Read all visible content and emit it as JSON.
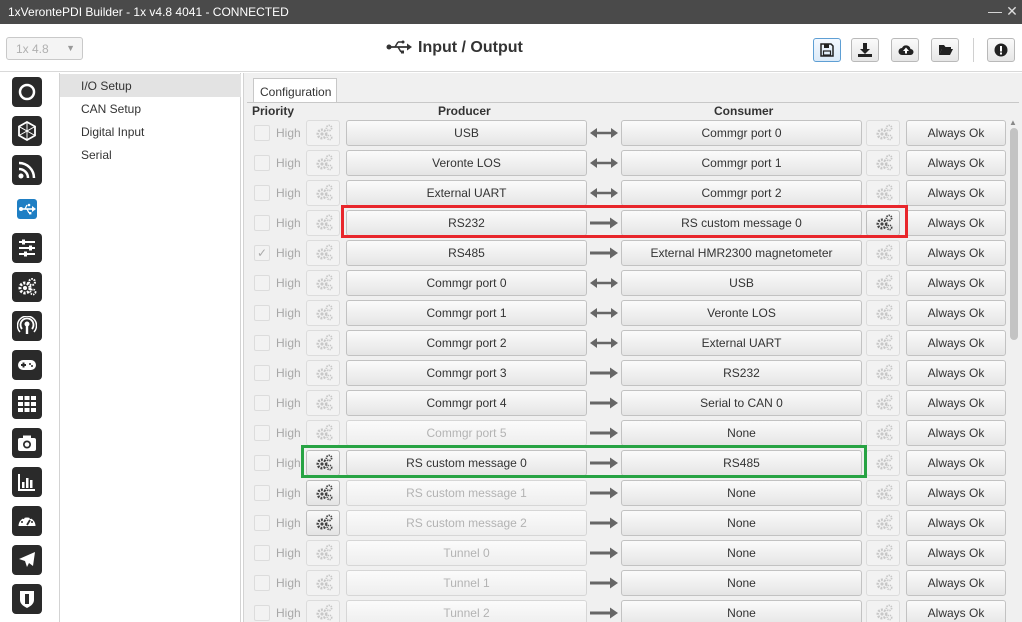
{
  "window": {
    "title": "1xVerontePDI Builder - 1x v4.8 4041 - CONNECTED"
  },
  "header": {
    "version_label": "1x 4.8",
    "page_title": "Input / Output"
  },
  "toolbar": [
    {
      "name": "save",
      "icon": "save-icon",
      "active": true
    },
    {
      "name": "download",
      "icon": "download-icon",
      "active": false
    },
    {
      "name": "upload-cloud",
      "icon": "cloud-upload-icon",
      "active": false
    },
    {
      "name": "open-folder",
      "icon": "folder-open-icon",
      "active": false
    },
    {
      "name": "alert",
      "icon": "exclamation-icon",
      "active": false
    }
  ],
  "rail": [
    {
      "icon": "power-icon",
      "active": false
    },
    {
      "icon": "hexagon-icon",
      "active": false
    },
    {
      "icon": "rss-icon",
      "active": false
    },
    {
      "icon": "usb-icon",
      "active": true
    },
    {
      "icon": "sliders-icon",
      "active": false
    },
    {
      "icon": "gears-icon",
      "active": false
    },
    {
      "icon": "podcast-icon",
      "active": false
    },
    {
      "icon": "gamepad-icon",
      "active": false
    },
    {
      "icon": "grid-icon",
      "active": false
    },
    {
      "icon": "camera-icon",
      "active": false
    },
    {
      "icon": "bar-chart-icon",
      "active": false
    },
    {
      "icon": "gauge-icon",
      "active": false
    },
    {
      "icon": "plane-icon",
      "active": false
    },
    {
      "icon": "shield-icon",
      "active": false
    }
  ],
  "menu": [
    {
      "label": "I/O Setup",
      "active": true
    },
    {
      "label": "CAN Setup",
      "active": false
    },
    {
      "label": "Digital Input",
      "active": false
    },
    {
      "label": "Serial",
      "active": false
    }
  ],
  "tab": {
    "label": "Configuration"
  },
  "columns": {
    "priority": "Priority",
    "producer": "Producer",
    "consumer": "Consumer"
  },
  "rows": [
    {
      "checked": false,
      "high": "High",
      "producer": "USB",
      "producer_enabled": true,
      "producer_gear": false,
      "arrow": "both",
      "consumer": "Commgr port 0",
      "consumer_gear": false,
      "status": "Always Ok"
    },
    {
      "checked": false,
      "high": "High",
      "producer": "Veronte LOS",
      "producer_enabled": true,
      "producer_gear": false,
      "arrow": "both",
      "consumer": "Commgr port 1",
      "consumer_gear": false,
      "status": "Always Ok"
    },
    {
      "checked": false,
      "high": "High",
      "producer": "External UART",
      "producer_enabled": true,
      "producer_gear": false,
      "arrow": "both",
      "consumer": "Commgr port 2",
      "consumer_gear": false,
      "status": "Always Ok"
    },
    {
      "checked": false,
      "high": "High",
      "producer": "RS232",
      "producer_enabled": true,
      "producer_gear": false,
      "arrow": "right",
      "consumer": "RS custom message 0",
      "consumer_gear": true,
      "status": "Always Ok"
    },
    {
      "checked": true,
      "high": "High",
      "producer": "RS485",
      "producer_enabled": true,
      "producer_gear": false,
      "arrow": "right",
      "consumer": "External HMR2300 magnetometer",
      "consumer_gear": false,
      "status": "Always Ok"
    },
    {
      "checked": false,
      "high": "High",
      "producer": "Commgr port 0",
      "producer_enabled": true,
      "producer_gear": false,
      "arrow": "both",
      "consumer": "USB",
      "consumer_gear": false,
      "status": "Always Ok"
    },
    {
      "checked": false,
      "high": "High",
      "producer": "Commgr port 1",
      "producer_enabled": true,
      "producer_gear": false,
      "arrow": "both",
      "consumer": "Veronte LOS",
      "consumer_gear": false,
      "status": "Always Ok"
    },
    {
      "checked": false,
      "high": "High",
      "producer": "Commgr port 2",
      "producer_enabled": true,
      "producer_gear": false,
      "arrow": "both",
      "consumer": "External UART",
      "consumer_gear": false,
      "status": "Always Ok"
    },
    {
      "checked": false,
      "high": "High",
      "producer": "Commgr port 3",
      "producer_enabled": true,
      "producer_gear": false,
      "arrow": "right",
      "consumer": "RS232",
      "consumer_gear": false,
      "status": "Always Ok"
    },
    {
      "checked": false,
      "high": "High",
      "producer": "Commgr port 4",
      "producer_enabled": true,
      "producer_gear": false,
      "arrow": "right",
      "consumer": "Serial to CAN 0",
      "consumer_gear": false,
      "status": "Always Ok"
    },
    {
      "checked": false,
      "high": "High",
      "producer": "Commgr port 5",
      "producer_enabled": false,
      "producer_gear": false,
      "arrow": "right",
      "consumer": "None",
      "consumer_gear": false,
      "status": "Always Ok"
    },
    {
      "checked": false,
      "high": "High",
      "producer": "RS custom message 0",
      "producer_enabled": true,
      "producer_gear": true,
      "arrow": "right",
      "consumer": "RS485",
      "consumer_gear": false,
      "status": "Always Ok"
    },
    {
      "checked": false,
      "high": "High",
      "producer": "RS custom message 1",
      "producer_enabled": false,
      "producer_gear": true,
      "arrow": "right",
      "consumer": "None",
      "consumer_gear": false,
      "status": "Always Ok"
    },
    {
      "checked": false,
      "high": "High",
      "producer": "RS custom message 2",
      "producer_enabled": false,
      "producer_gear": true,
      "arrow": "right",
      "consumer": "None",
      "consumer_gear": false,
      "status": "Always Ok"
    },
    {
      "checked": false,
      "high": "High",
      "producer": "Tunnel 0",
      "producer_enabled": false,
      "producer_gear": false,
      "arrow": "right",
      "consumer": "None",
      "consumer_gear": false,
      "status": "Always Ok"
    },
    {
      "checked": false,
      "high": "High",
      "producer": "Tunnel 1",
      "producer_enabled": false,
      "producer_gear": false,
      "arrow": "right",
      "consumer": "None",
      "consumer_gear": false,
      "status": "Always Ok"
    },
    {
      "checked": false,
      "high": "High",
      "producer": "Tunnel 2",
      "producer_enabled": false,
      "producer_gear": false,
      "arrow": "right",
      "consumer": "None",
      "consumer_gear": false,
      "status": "Always Ok"
    }
  ],
  "highlights": [
    {
      "row": 3,
      "color": "#e8262b"
    },
    {
      "row": 11,
      "color": "#27a343"
    }
  ],
  "colors": {
    "rail_icon_bg": "#2a2a2a",
    "active_accent": "#1f7fc4",
    "arrow": "#666666"
  }
}
